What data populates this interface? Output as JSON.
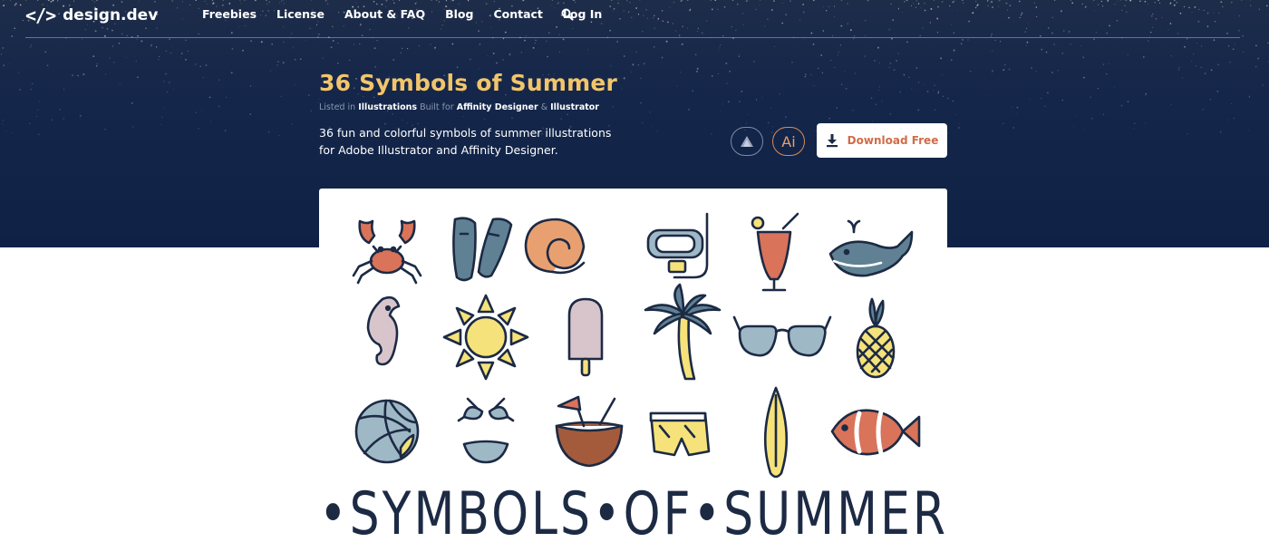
{
  "nav": {
    "logo_mark": "</>",
    "logo_text": "design.dev",
    "links": [
      "Freebies",
      "License",
      "About & FAQ",
      "Blog",
      "Contact",
      "Log In"
    ],
    "search_icon": "search-icon"
  },
  "product": {
    "title": "36 Symbols of Summer",
    "listed_prefix": "Listed in ",
    "listed_category": "Illustrations",
    "built_for_prefix": " Built for ",
    "built_for_app1": "Affinity Designer",
    "built_for_sep": " & ",
    "built_for_app2": "Illustrator",
    "description": "36 fun and colorful symbols of summer illustrations for Adobe Illustrator and Affinity Designer.",
    "badges": [
      {
        "name": "affinity-icon"
      },
      {
        "name": "illustrator-icon",
        "label": "Ai"
      }
    ],
    "download_label": "Download Free",
    "download_icon": "download-icon"
  },
  "preview": {
    "caption": "•SYMBOLS•OF•SUMMER•",
    "icons": [
      "crab-icon",
      "flippers-icon",
      "nautilus-shell-icon",
      "snorkel-mask-icon",
      "cocktail-icon",
      "whale-icon",
      "seahorse-icon",
      "sun-icon",
      "popsicle-icon",
      "palm-tree-icon",
      "sunglasses-icon",
      "pineapple-icon",
      "volleyball-icon",
      "bikini-icon",
      "coconut-drink-icon",
      "swim-shorts-icon",
      "surfboard-icon",
      "clownfish-icon"
    ]
  },
  "colors": {
    "hero_bg": "#14264a",
    "title": "#f2c56b",
    "accent": "#d16b48",
    "ink": "#1c2a44",
    "coral": "#d9735a",
    "slate": "#5f8193",
    "yellow": "#f5e27a",
    "blush": "#d8c5cc",
    "sky": "#9fb8c6"
  }
}
